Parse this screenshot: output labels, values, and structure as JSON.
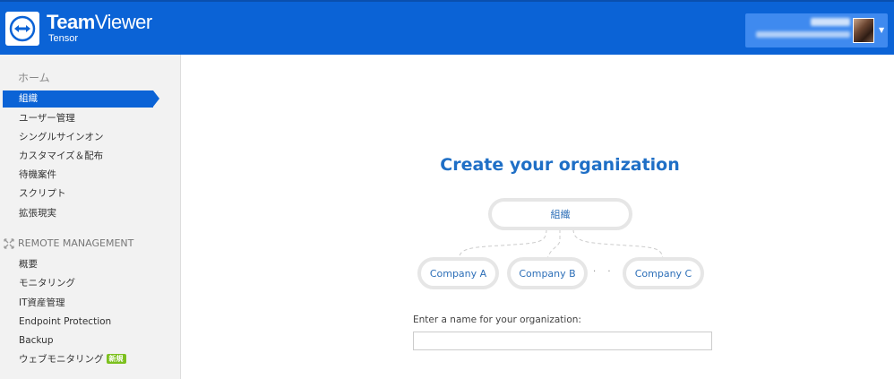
{
  "header": {
    "brand": "TeamViewer",
    "brand_bold": "Team",
    "brand_thin": "Viewer",
    "brand_sub": "Tensor",
    "logo_icon": "teamviewer-arrows-icon",
    "user_menu_icon": "chevron-down-icon"
  },
  "sidebar": {
    "home": "ホーム",
    "items": [
      {
        "label": "組織",
        "active": true
      },
      {
        "label": "ユーザー管理"
      },
      {
        "label": "シングルサインオン"
      },
      {
        "label": "カスタマイズ＆配布"
      },
      {
        "label": "待機案件"
      },
      {
        "label": "スクリプト"
      },
      {
        "label": "拡張現実"
      }
    ],
    "remote_management": {
      "title": "REMOTE MANAGEMENT",
      "icon": "expand-arrows-icon",
      "items": [
        {
          "label": "概要"
        },
        {
          "label": "モニタリング"
        },
        {
          "label": "IT資産管理"
        },
        {
          "label": "Endpoint Protection"
        },
        {
          "label": "Backup"
        },
        {
          "label": "ウェブモニタリング",
          "badge": "新規"
        }
      ]
    }
  },
  "main": {
    "title": "Create your organization",
    "diagram": {
      "root": "組織",
      "children": [
        "Company A",
        "Company B",
        "Company C"
      ],
      "ellipsis": "· · ·"
    },
    "org_name_label": "Enter a name for your organization:",
    "org_name_value": "",
    "org_name_placeholder": ""
  },
  "colors": {
    "header_blue": "#0b63d6",
    "title_blue": "#1f6fc6",
    "badge_green": "#7cc01e"
  }
}
